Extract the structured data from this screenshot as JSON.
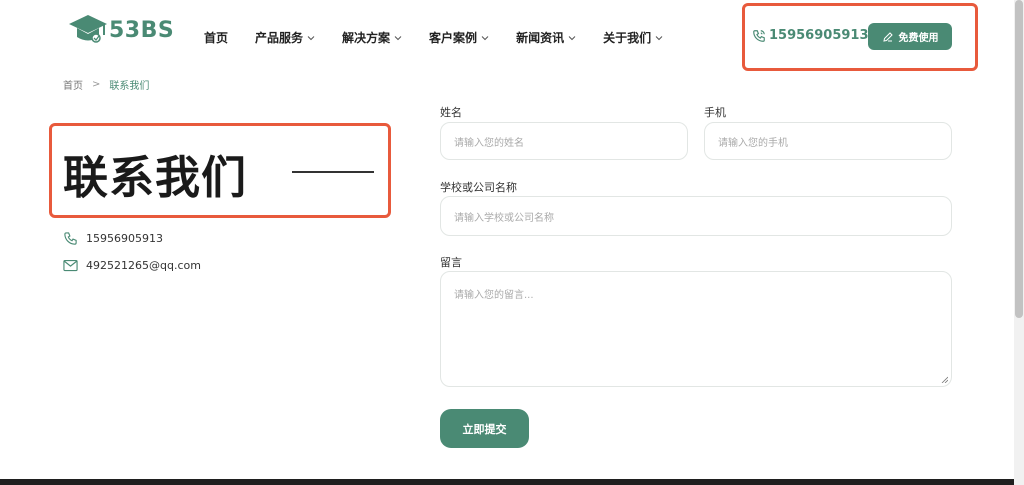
{
  "header": {
    "logo_text": "53BS",
    "nav": [
      {
        "label": "首页",
        "has_dropdown": false
      },
      {
        "label": "产品服务",
        "has_dropdown": true
      },
      {
        "label": "解决方案",
        "has_dropdown": true
      },
      {
        "label": "客户案例",
        "has_dropdown": true
      },
      {
        "label": "新闻资讯",
        "has_dropdown": true
      },
      {
        "label": "关于我们",
        "has_dropdown": true
      }
    ],
    "hotline": "15956905913",
    "free_button": "免费使用"
  },
  "breadcrumb": {
    "home": "首页",
    "separator": ">",
    "current": "联系我们"
  },
  "contact": {
    "title": "联系我们",
    "phone": "15956905913",
    "email": "492521265@qq.com"
  },
  "form": {
    "name_label": "姓名",
    "name_placeholder": "请输入您的姓名",
    "phone_label": "手机",
    "phone_placeholder": "请输入您的手机",
    "company_label": "学校或公司名称",
    "company_placeholder": "请输入学校或公司名称",
    "message_label": "留言",
    "message_placeholder": "请输入您的留言...",
    "submit": "立即提交"
  },
  "colors": {
    "brand": "#4a8a74",
    "highlight": "#e85a3c"
  }
}
